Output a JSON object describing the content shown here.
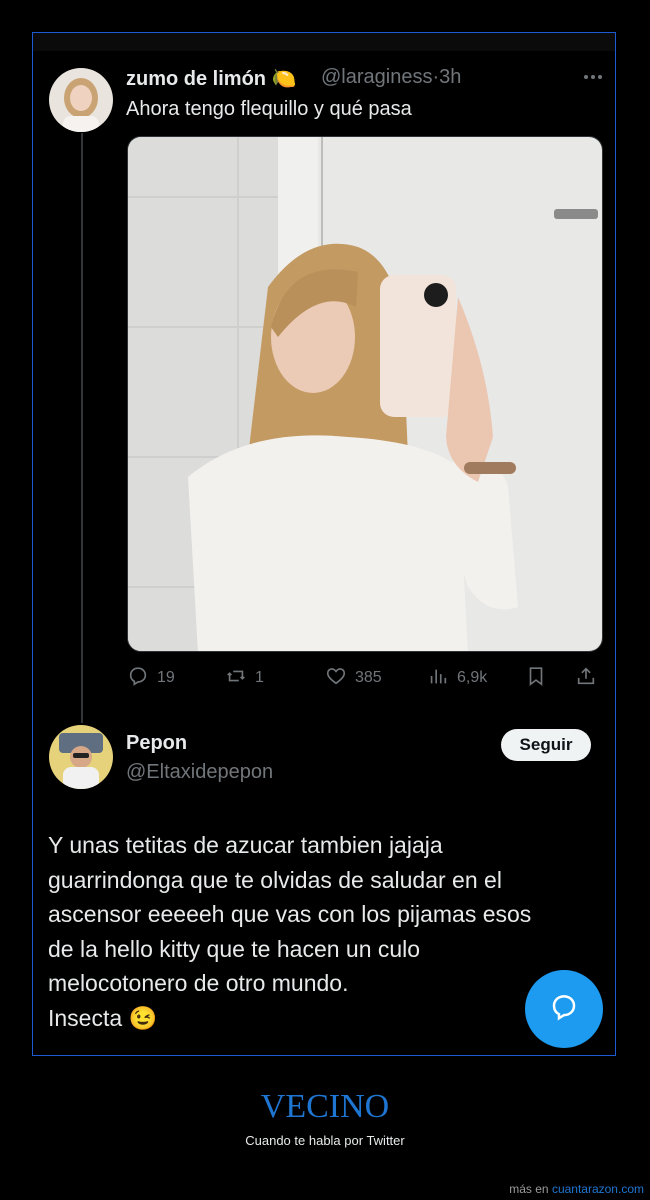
{
  "tweet": {
    "author_name": "zumo de limón",
    "author_emoji": "🍋",
    "handle": "@laraginess",
    "separator": "·",
    "time": "3h",
    "text": "Ahora tengo flequillo y qué pasa",
    "more_icon": "more-horizontal-icon",
    "stats": {
      "replies": "19",
      "retweets": "1",
      "likes": "385",
      "views": "6,9k"
    }
  },
  "reply": {
    "author_name": "Pepon",
    "handle": "@Eltaxidepepon",
    "follow_label": "Seguir",
    "text": "Y unas tetitas de azucar tambien jajaja\nguarrindonga que te olvidas de saludar en el\nascensor eeeeeh que vas con los pijamas esos\nde la hello kitty que te hacen un culo\nmelocotonero de otro mundo.\nInsecta 😉"
  },
  "fab_icon": "compose-reply-icon",
  "caption": {
    "title": "VECINO",
    "subtitle": "Cuando te habla por Twitter"
  },
  "footer": {
    "prefix": "más en",
    "link": "cuantarazon.com"
  },
  "colors": {
    "accent": "#1d9bf0",
    "frame_border": "#1d5bd6",
    "caption": "#1f76d2",
    "muted": "#71767b"
  }
}
